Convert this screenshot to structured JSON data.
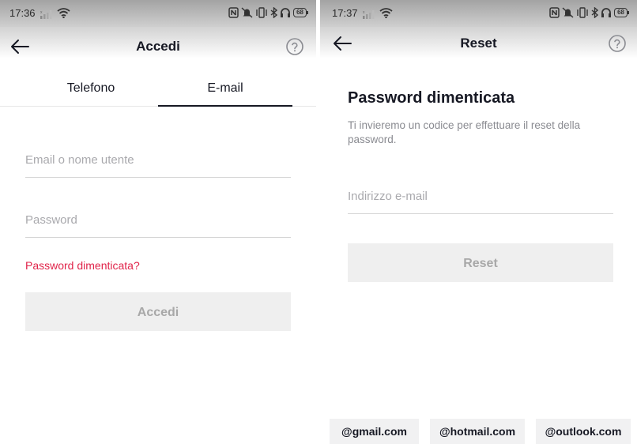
{
  "left_screen": {
    "status_bar": {
      "time": "17:36",
      "battery": "68",
      "icons": [
        "signal-icon",
        "wifi-icon",
        "nfc-icon",
        "notifications-off-icon",
        "vibrate-icon",
        "bluetooth-icon",
        "headphones-icon",
        "battery-icon"
      ]
    },
    "nav": {
      "back_icon": "arrow-left-icon",
      "title": "Accedi",
      "help_icon": "help-circle-icon"
    },
    "tabs": [
      {
        "label": "Telefono",
        "active": false
      },
      {
        "label": "E-mail",
        "active": true
      }
    ],
    "form": {
      "username": {
        "placeholder": "Email o nome utente",
        "value": ""
      },
      "password": {
        "placeholder": "Password",
        "value": ""
      },
      "forgot_link": "Password dimenticata?",
      "submit_label": "Accedi"
    },
    "colors": {
      "link": "#e0244a",
      "button_disabled_bg": "#efefef",
      "button_disabled_text": "#a8a8a8"
    }
  },
  "right_screen": {
    "status_bar": {
      "time": "17:37",
      "battery": "68",
      "icons": [
        "signal-icon",
        "wifi-icon",
        "nfc-icon",
        "notifications-off-icon",
        "vibrate-icon",
        "bluetooth-icon",
        "headphones-icon",
        "battery-icon"
      ]
    },
    "nav": {
      "back_icon": "arrow-left-icon",
      "title": "Reset",
      "help_icon": "help-circle-icon"
    },
    "heading": "Password dimenticata",
    "subtitle": "Ti invieremo un codice per effettuare il reset della password.",
    "email": {
      "placeholder": "Indirizzo e-mail",
      "value": ""
    },
    "submit_label": "Reset",
    "domain_suggestions": [
      "@gmail.com",
      "@hotmail.com",
      "@outlook.com"
    ]
  }
}
